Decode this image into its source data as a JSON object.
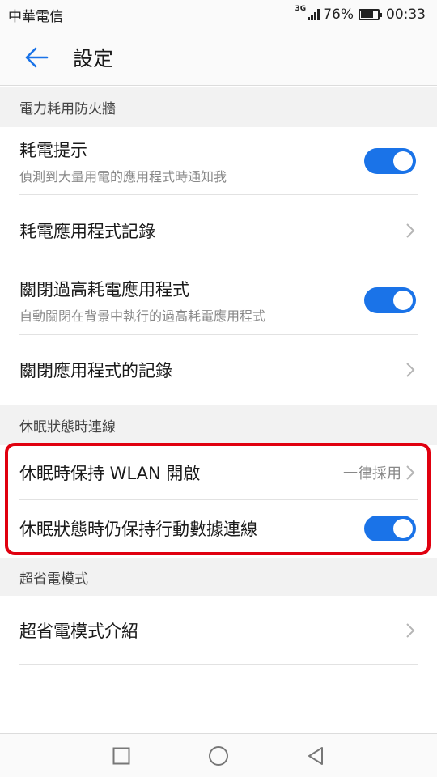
{
  "status_bar": {
    "carrier": "中華電信",
    "network_type": "3G",
    "battery_percent": "76%",
    "battery_level": 0.76,
    "time": "00:33"
  },
  "app_bar": {
    "back_icon": "arrow-back-icon",
    "title": "設定"
  },
  "accent_color": "#1a73e8",
  "highlight_color": "#e0000f",
  "sections": [
    {
      "header": "電力耗用防火牆",
      "items": [
        {
          "title": "耗電提示",
          "subtitle": "偵測到大量用電的應用程式時通知我",
          "control": "toggle",
          "checked": true
        },
        {
          "title": "耗電應用程式記錄",
          "control": "chevron"
        },
        {
          "title": "關閉過高耗電應用程式",
          "subtitle": "自動關閉在背景中執行的過高耗電應用程式",
          "control": "toggle",
          "checked": true
        },
        {
          "title": "關閉應用程式的記錄",
          "control": "chevron"
        }
      ]
    },
    {
      "header": "休眠狀態時連線",
      "items": [
        {
          "title": "休眠時保持 WLAN 開啟",
          "value": "一律採用",
          "control": "chevron"
        },
        {
          "title": "休眠狀態時仍保持行動數據連線",
          "control": "toggle",
          "checked": true
        }
      ]
    },
    {
      "header": "超省電模式",
      "items": [
        {
          "title": "超省電模式介紹",
          "control": "chevron"
        }
      ]
    }
  ],
  "nav_bar": {
    "buttons": [
      "recents-square-icon",
      "home-circle-icon",
      "back-triangle-icon"
    ]
  }
}
